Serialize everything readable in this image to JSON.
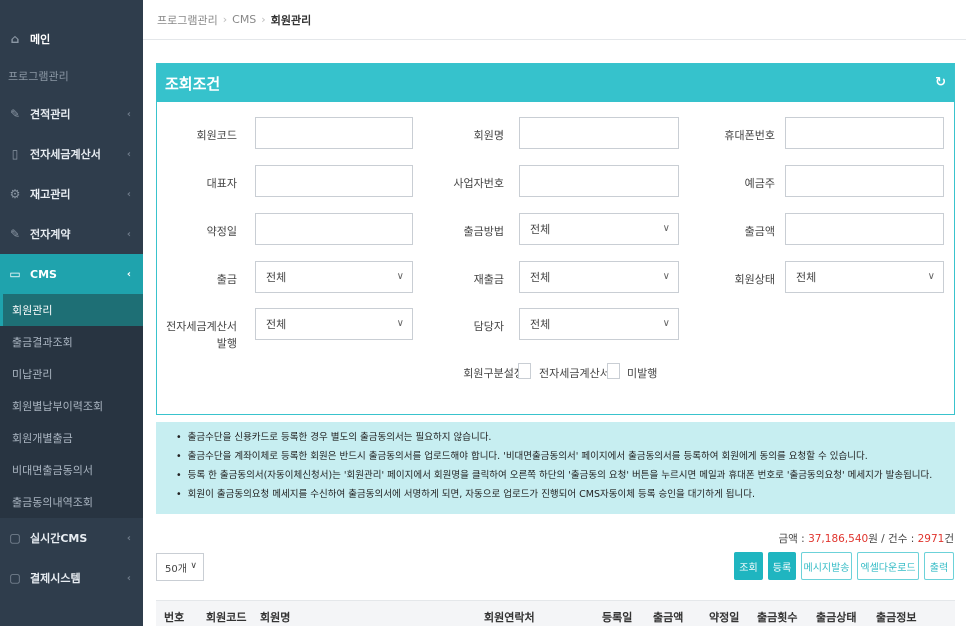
{
  "sidebar": {
    "home": "메인",
    "section": "프로그램관리",
    "menus": [
      {
        "label": "견적관리",
        "icon": "edit-icon"
      },
      {
        "label": "전자세금계산서",
        "icon": "document-icon"
      },
      {
        "label": "재고관리",
        "icon": "settings-icon"
      },
      {
        "label": "전자계약",
        "icon": "edit-icon"
      }
    ],
    "active": {
      "label": "CMS",
      "icon": "card-icon"
    },
    "submenu": [
      "회원관리",
      "출금결과조회",
      "미납관리",
      "회원별납부이력조회",
      "회원개별출금",
      "비대면출금동의서",
      "출금동의내역조회"
    ],
    "after": [
      {
        "label": "실시간CMS",
        "icon": "folder-icon"
      },
      {
        "label": "결제시스템",
        "icon": "folder-icon"
      }
    ]
  },
  "breadcrumb": {
    "item1": "프로그램관리",
    "item2": "CMS",
    "current": "회원관리"
  },
  "panel": {
    "title": "조회조건",
    "labels": {
      "member_code": "회원코드",
      "member_name": "회원명",
      "mobile": "휴대폰번호",
      "representative": "대표자",
      "business_no": "사업자번호",
      "depositor": "예금주",
      "contract_date": "약정일",
      "withdraw_method": "출금방법",
      "withdraw_amount": "출금액",
      "withdraw": "출금",
      "rewithdraw": "재출금",
      "member_status": "회원상태",
      "tax_invoice_line1": "전자세금계산서",
      "tax_invoice_line2": "발행",
      "manager": "담당자",
      "member_type": "회원구분설정"
    },
    "select_value": "전체",
    "checkbox1": "전자세금계산서",
    "checkbox2": "미발행"
  },
  "notices": [
    "출금수단을 신용카드로 등록한 경우 별도의 출금동의서는 필요하지 않습니다.",
    "출금수단을 계좌이체로 등록한 회원은 반드시 출금동의서를 업로드해야 합니다. '비대면출금동의서' 페이지에서 출금동의서를 등록하여 회원에게 동의를 요청할 수 있습니다.",
    "등록 한 출금동의서(자동이체신청서)는 '회원관리' 페이지에서 회원명을 클릭하여 오른쪽 하단의 '출금동의 요청' 버튼을 누르시면 메일과 휴대폰 번호로 '출금동의요청' 메세지가 발송됩니다.",
    "회원이 출금동의요청 메세지를 수신하여 출금동의서에 서명하게 되면, 자동으로 업로드가 진행되어 CMS자동이체 등록 승인을 대기하게 됩니다."
  ],
  "summary": {
    "amount_label": "금액 : ",
    "amount": "37,186,540",
    "amount_unit": "원 / 건수 : ",
    "count": "2971",
    "count_unit": "건"
  },
  "page_size": "50개",
  "buttons": {
    "search": "조회",
    "register": "등록",
    "send_message": "메시지발송",
    "excel": "엑셀다운로드",
    "print": "출력"
  },
  "table_headers": [
    "번호",
    "회원코드",
    "회원명",
    "회원연락처",
    "등록일",
    "출금액",
    "약정일",
    "출금횟수",
    "출금상태",
    "출금정보"
  ]
}
